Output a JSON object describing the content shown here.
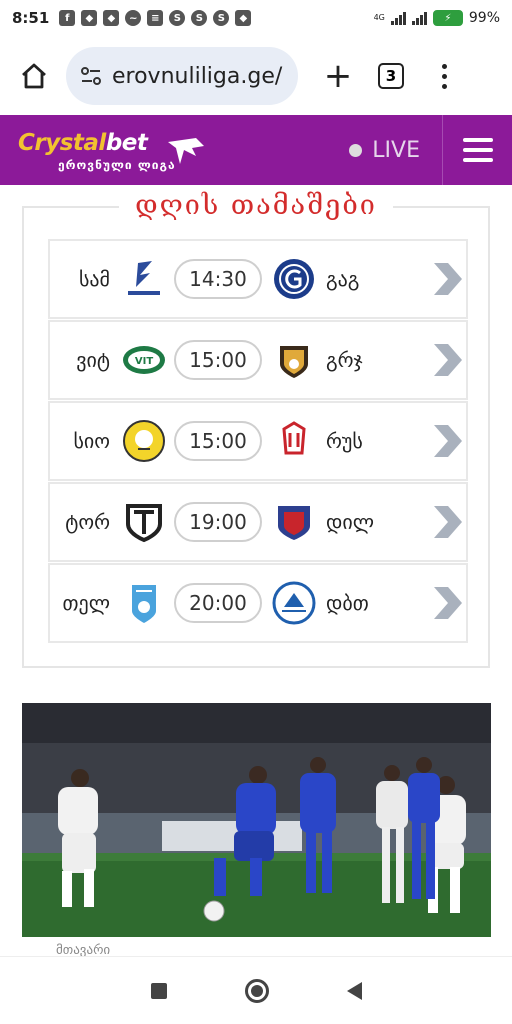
{
  "status_bar": {
    "time": "8:51",
    "network": "4G",
    "battery": "99%"
  },
  "browser": {
    "url": "erovnuliliga.ge/",
    "tab_count": "3"
  },
  "header": {
    "logo_text_a": "Crystal",
    "logo_text_b": "bet",
    "logo_sub": "ეროვნული ლიგა",
    "live_label": "LIVE"
  },
  "games": {
    "title": "დღის თამაშები",
    "rows": [
      {
        "home": "სამ",
        "time": "14:30",
        "away": "გაგ",
        "home_crest": "samtredia-crest",
        "away_crest": "gagra-crest"
      },
      {
        "home": "ვიტ",
        "time": "15:00",
        "away": "გრჯ",
        "home_crest": "vit-crest",
        "away_crest": "gareji-crest"
      },
      {
        "home": "სიო",
        "time": "15:00",
        "away": "რუს",
        "home_crest": "sioni-crest",
        "away_crest": "rustavi-crest"
      },
      {
        "home": "ტორ",
        "time": "19:00",
        "away": "დილ",
        "home_crest": "torpedo-crest",
        "away_crest": "dila-crest"
      },
      {
        "home": "თელ",
        "time": "20:00",
        "away": "დბთ",
        "home_crest": "telavi-crest",
        "away_crest": "dinamo-batumi-crest"
      }
    ]
  },
  "article": {
    "caption": "მთავარი"
  },
  "colors": {
    "brand_purple": "#8c1a99",
    "logo_yellow": "#f2c230",
    "title_red": "#d32c2c",
    "chevron_gray": "#a9b1bd"
  }
}
